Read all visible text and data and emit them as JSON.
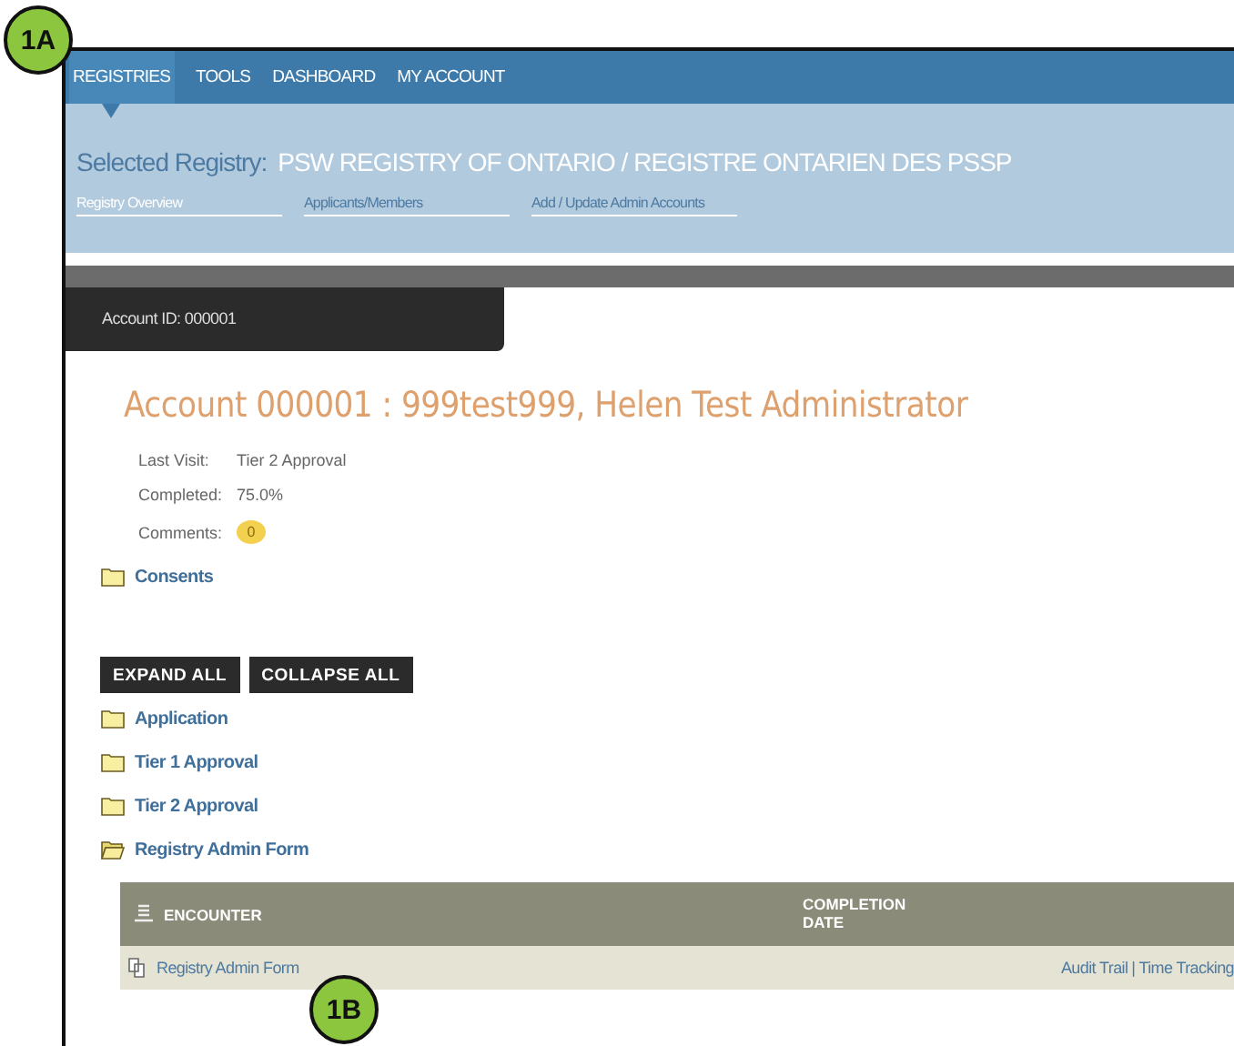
{
  "callouts": [
    {
      "label": "1A"
    },
    {
      "label": "1B"
    }
  ],
  "top_nav": [
    {
      "label": "REGISTRIES",
      "selected": true
    },
    {
      "label": "TOOLS",
      "selected": false
    },
    {
      "label": "DASHBOARD",
      "selected": false
    },
    {
      "label": "MY ACCOUNT",
      "selected": false
    }
  ],
  "selected_registry": {
    "label": "Selected Registry:",
    "value": "PSW REGISTRY OF ONTARIO / REGISTRE ONTARIEN DES PSSP"
  },
  "sub_nav": [
    {
      "label": "Registry Overview",
      "selected": true
    },
    {
      "label": "Applicants/Members",
      "selected": false
    },
    {
      "label": "Add / Update Admin Accounts",
      "selected": false
    }
  ],
  "account_tab": {
    "label": "Account ID: 000001"
  },
  "account_title": "Account 000001 : 999test999, Helen Test Administrator",
  "details": [
    {
      "label": "Last Visit:",
      "value": "Tier 2 Approval",
      "kind": "text"
    },
    {
      "label": "Completed:",
      "value": "75.0%",
      "kind": "text"
    },
    {
      "label": "Comments:",
      "value": "0",
      "kind": "bubble"
    }
  ],
  "consents": {
    "label": "Consents",
    "expanded": false
  },
  "buttons": [
    "EXPAND ALL",
    "COLLAPSE ALL"
  ],
  "folders": [
    {
      "label": "Application",
      "expanded": false
    },
    {
      "label": "Tier 1 Approval",
      "expanded": false
    },
    {
      "label": "Tier 2 Approval",
      "expanded": false
    },
    {
      "label": "Registry Admin Form",
      "expanded": true
    }
  ],
  "table": {
    "columns": [
      "ENCOUNTER",
      "COMPLETION DATE"
    ],
    "rows": [
      {
        "encounter": "Registry Admin Form",
        "links": [
          "Audit Trail",
          "Time Tracking"
        ],
        "separator": "|"
      }
    ]
  }
}
